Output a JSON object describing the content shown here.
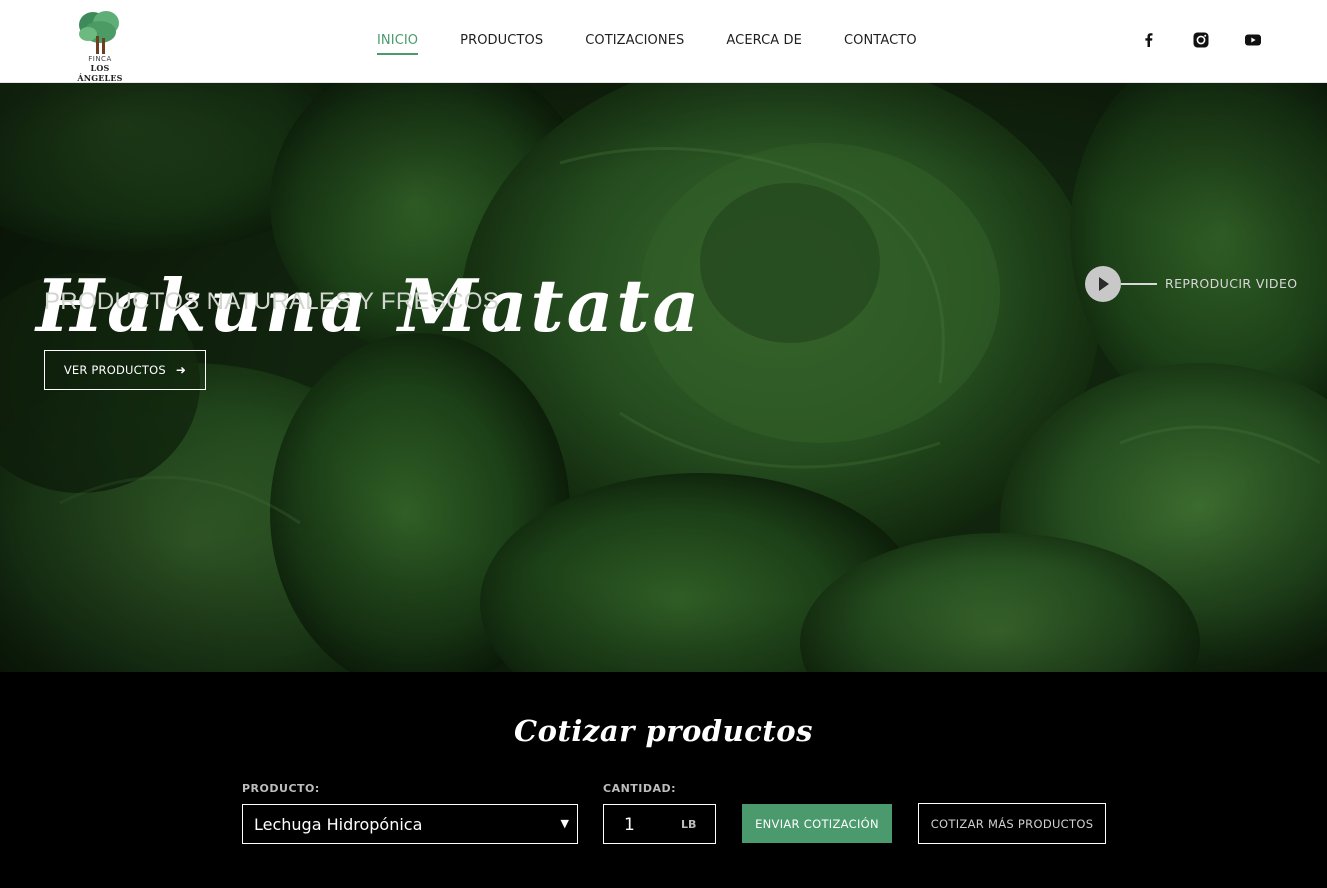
{
  "brand": {
    "logo_small": "FINCA",
    "logo_name": "LOS ÁNGELES"
  },
  "nav": {
    "items": [
      {
        "label": "INICIO",
        "active": true
      },
      {
        "label": "PRODUCTOS",
        "active": false
      },
      {
        "label": "COTIZACIONES",
        "active": false
      },
      {
        "label": "ACERCA DE",
        "active": false
      },
      {
        "label": "CONTACTO",
        "active": false
      }
    ],
    "social": [
      "facebook-icon",
      "instagram-icon",
      "youtube-icon"
    ]
  },
  "hero": {
    "title": "Hakuna  Matata",
    "subtitle": "PRODUCTOS NATURALES Y FRESCOS",
    "cta_label": "VER PRODUCTOS",
    "cta_icon": "arrow-right-icon",
    "video_label": "REPRODUCIR VIDEO",
    "video_icon": "play-icon"
  },
  "quote": {
    "title": "Cotizar productos",
    "product_label": "PRODUCTO:",
    "product_value": "Lechuga Hidropónica",
    "quantity_label": "CANTIDAD:",
    "quantity_value": "1",
    "quantity_unit": "LB",
    "send_label": "ENVIAR COTIZACIÓN",
    "more_label": "COTIZAR MÁS PRODUCTOS"
  },
  "colors": {
    "accent": "#4a9a6e",
    "background_dark": "#000000",
    "hero_green": "#2f5a26"
  }
}
